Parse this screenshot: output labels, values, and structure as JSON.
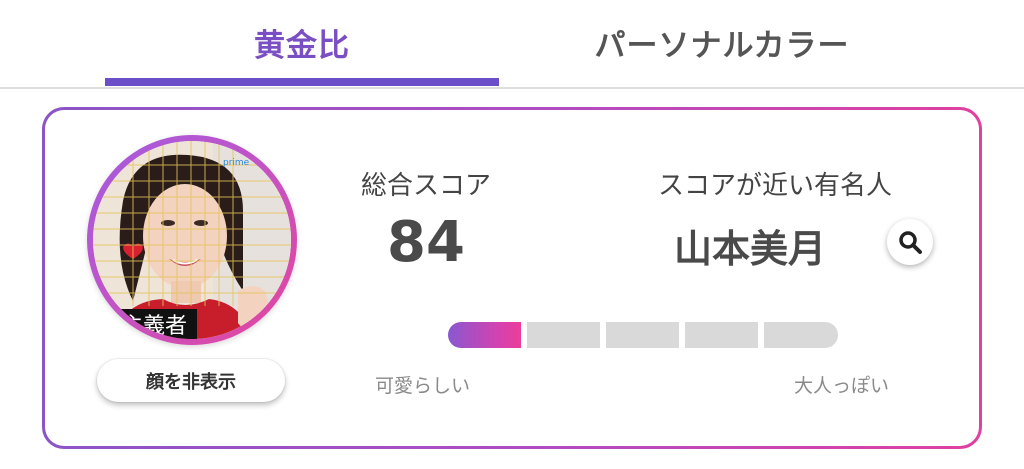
{
  "tabs": {
    "golden_ratio": "黄金比",
    "personal_color": "パーソナルカラー"
  },
  "profile": {
    "hide_face_label": "顔を非表示",
    "avatar_caption": "主義者"
  },
  "score": {
    "label": "総合スコア",
    "value": "84"
  },
  "celebrity": {
    "label": "スコアが近い有名人",
    "name": "山本美月"
  },
  "scale": {
    "left_label": "可愛らしい",
    "right_label": "大人っぽい",
    "segments": 5,
    "active_segment": 1
  },
  "colors": {
    "accent": "#7a4fc4",
    "tab_underline": "#6a4fc8",
    "border_gradient_start": "#8a55c8",
    "border_gradient_end": "#e0409f",
    "scale_inactive": "#d9d9d9"
  }
}
